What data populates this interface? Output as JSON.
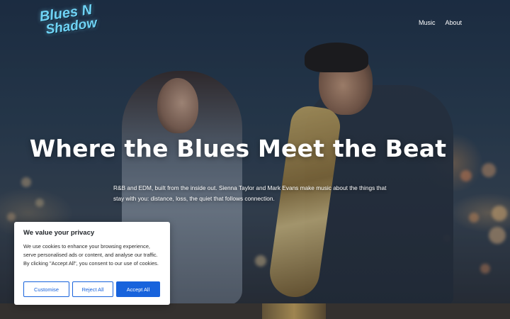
{
  "brand": {
    "logo_line1": "Blues N",
    "logo_line2": "Shadow"
  },
  "nav": {
    "items": [
      {
        "label": "Music"
      },
      {
        "label": "About"
      }
    ]
  },
  "hero": {
    "headline": "Where the Blues Meet the Beat",
    "tagline": "R&B and EDM, built from the inside out. Sienna Taylor and Mark Evans make music about the things that stay with you: distance, loss, the quiet that follows connection."
  },
  "cookie_banner": {
    "title": "We value your privacy",
    "body": "We use cookies to enhance your browsing experience, serve personalised ads or content, and analyse our traffic. By clicking \"Accept All\", you consent to our use of cookies.",
    "customise_label": "Customise",
    "reject_label": "Reject All",
    "accept_label": "Accept All"
  },
  "colors": {
    "accent": "#1863dc",
    "logo": "#6fd3f5"
  }
}
